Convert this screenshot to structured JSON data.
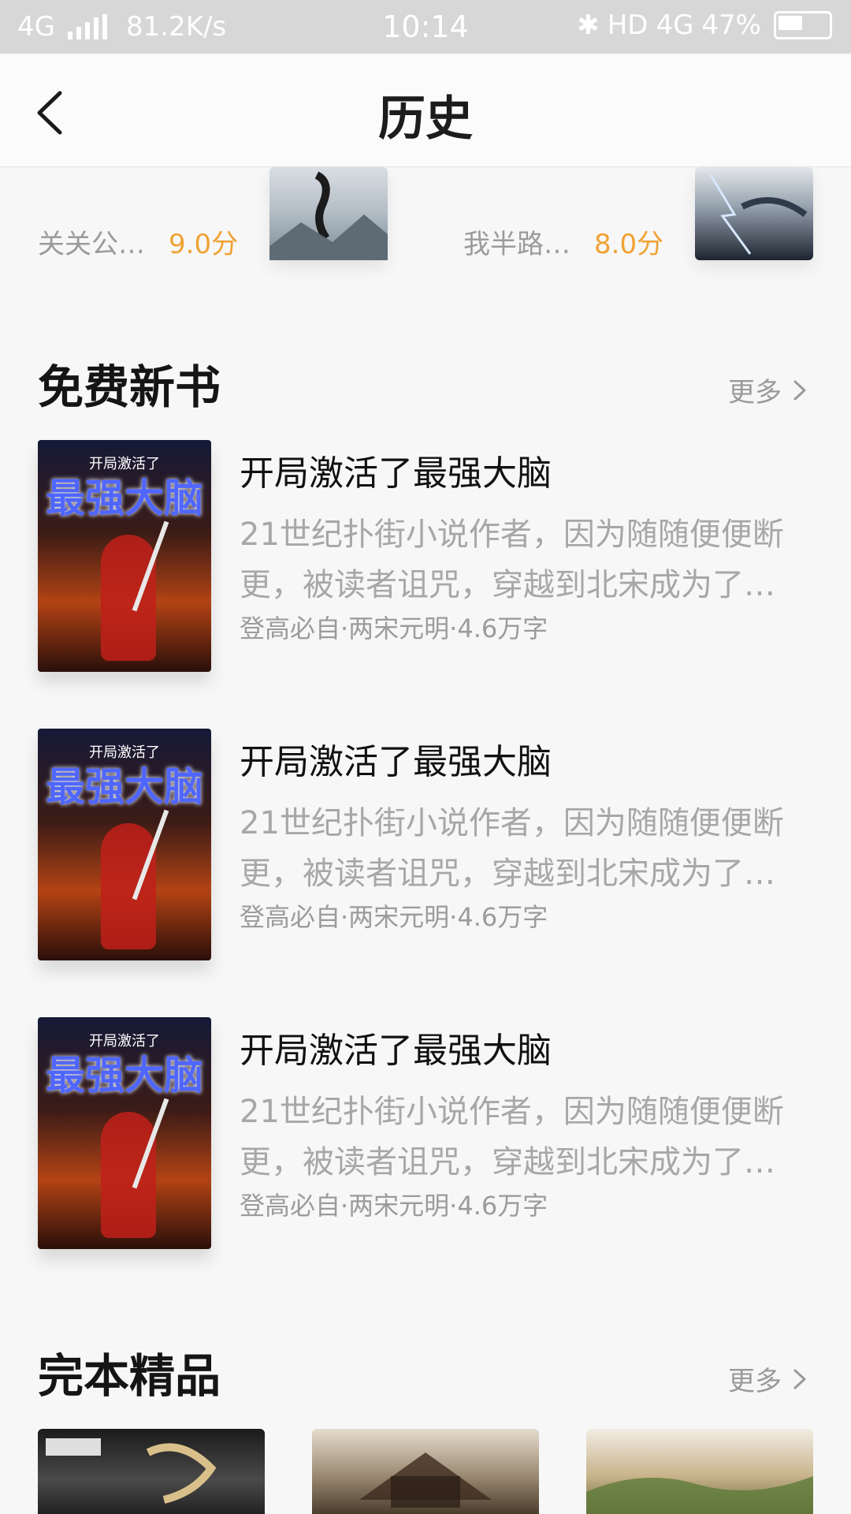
{
  "status": {
    "network_left": "4G",
    "speed": "81.2K/s",
    "time": "10:14",
    "hd": "HD",
    "network_right": "4G",
    "battery": "47%"
  },
  "header": {
    "title": "历史"
  },
  "top_row": [
    {
      "author": "关关公…",
      "score": "9.0分"
    },
    {
      "author": "我半路…",
      "score": "8.0分"
    }
  ],
  "free_new": {
    "title": "免费新书",
    "more": "更多",
    "items": [
      {
        "title": "开局激活了最强大脑",
        "desc": "21世纪扑街小说作者，因为随随便便断更，被读者诅咒，穿越到北宋成为了…",
        "meta": "登高必自·两宋元明·4.6万字",
        "cover_title": "最强大脑",
        "cover_sub": "开局激活了"
      },
      {
        "title": "开局激活了最强大脑",
        "desc": "21世纪扑街小说作者，因为随随便便断更，被读者诅咒，穿越到北宋成为了…",
        "meta": "登高必自·两宋元明·4.6万字",
        "cover_title": "最强大脑",
        "cover_sub": "开局激活了"
      },
      {
        "title": "开局激活了最强大脑",
        "desc": "21世纪扑街小说作者，因为随随便便断更，被读者诅咒，穿越到北宋成为了…",
        "meta": "登高必自·两宋元明·4.6万字",
        "cover_title": "最强大脑",
        "cover_sub": "开局激活了"
      }
    ]
  },
  "complete": {
    "title": "完本精品",
    "more": "更多"
  },
  "colors": {
    "accent": "#f0a234",
    "text_muted": "#a7a7a7",
    "status_bar": "#d7d7d7"
  },
  "icons": [
    "back-arrow-icon",
    "chevron-right-icon",
    "signal-icon",
    "battery-icon",
    "bluetooth-icon"
  ]
}
